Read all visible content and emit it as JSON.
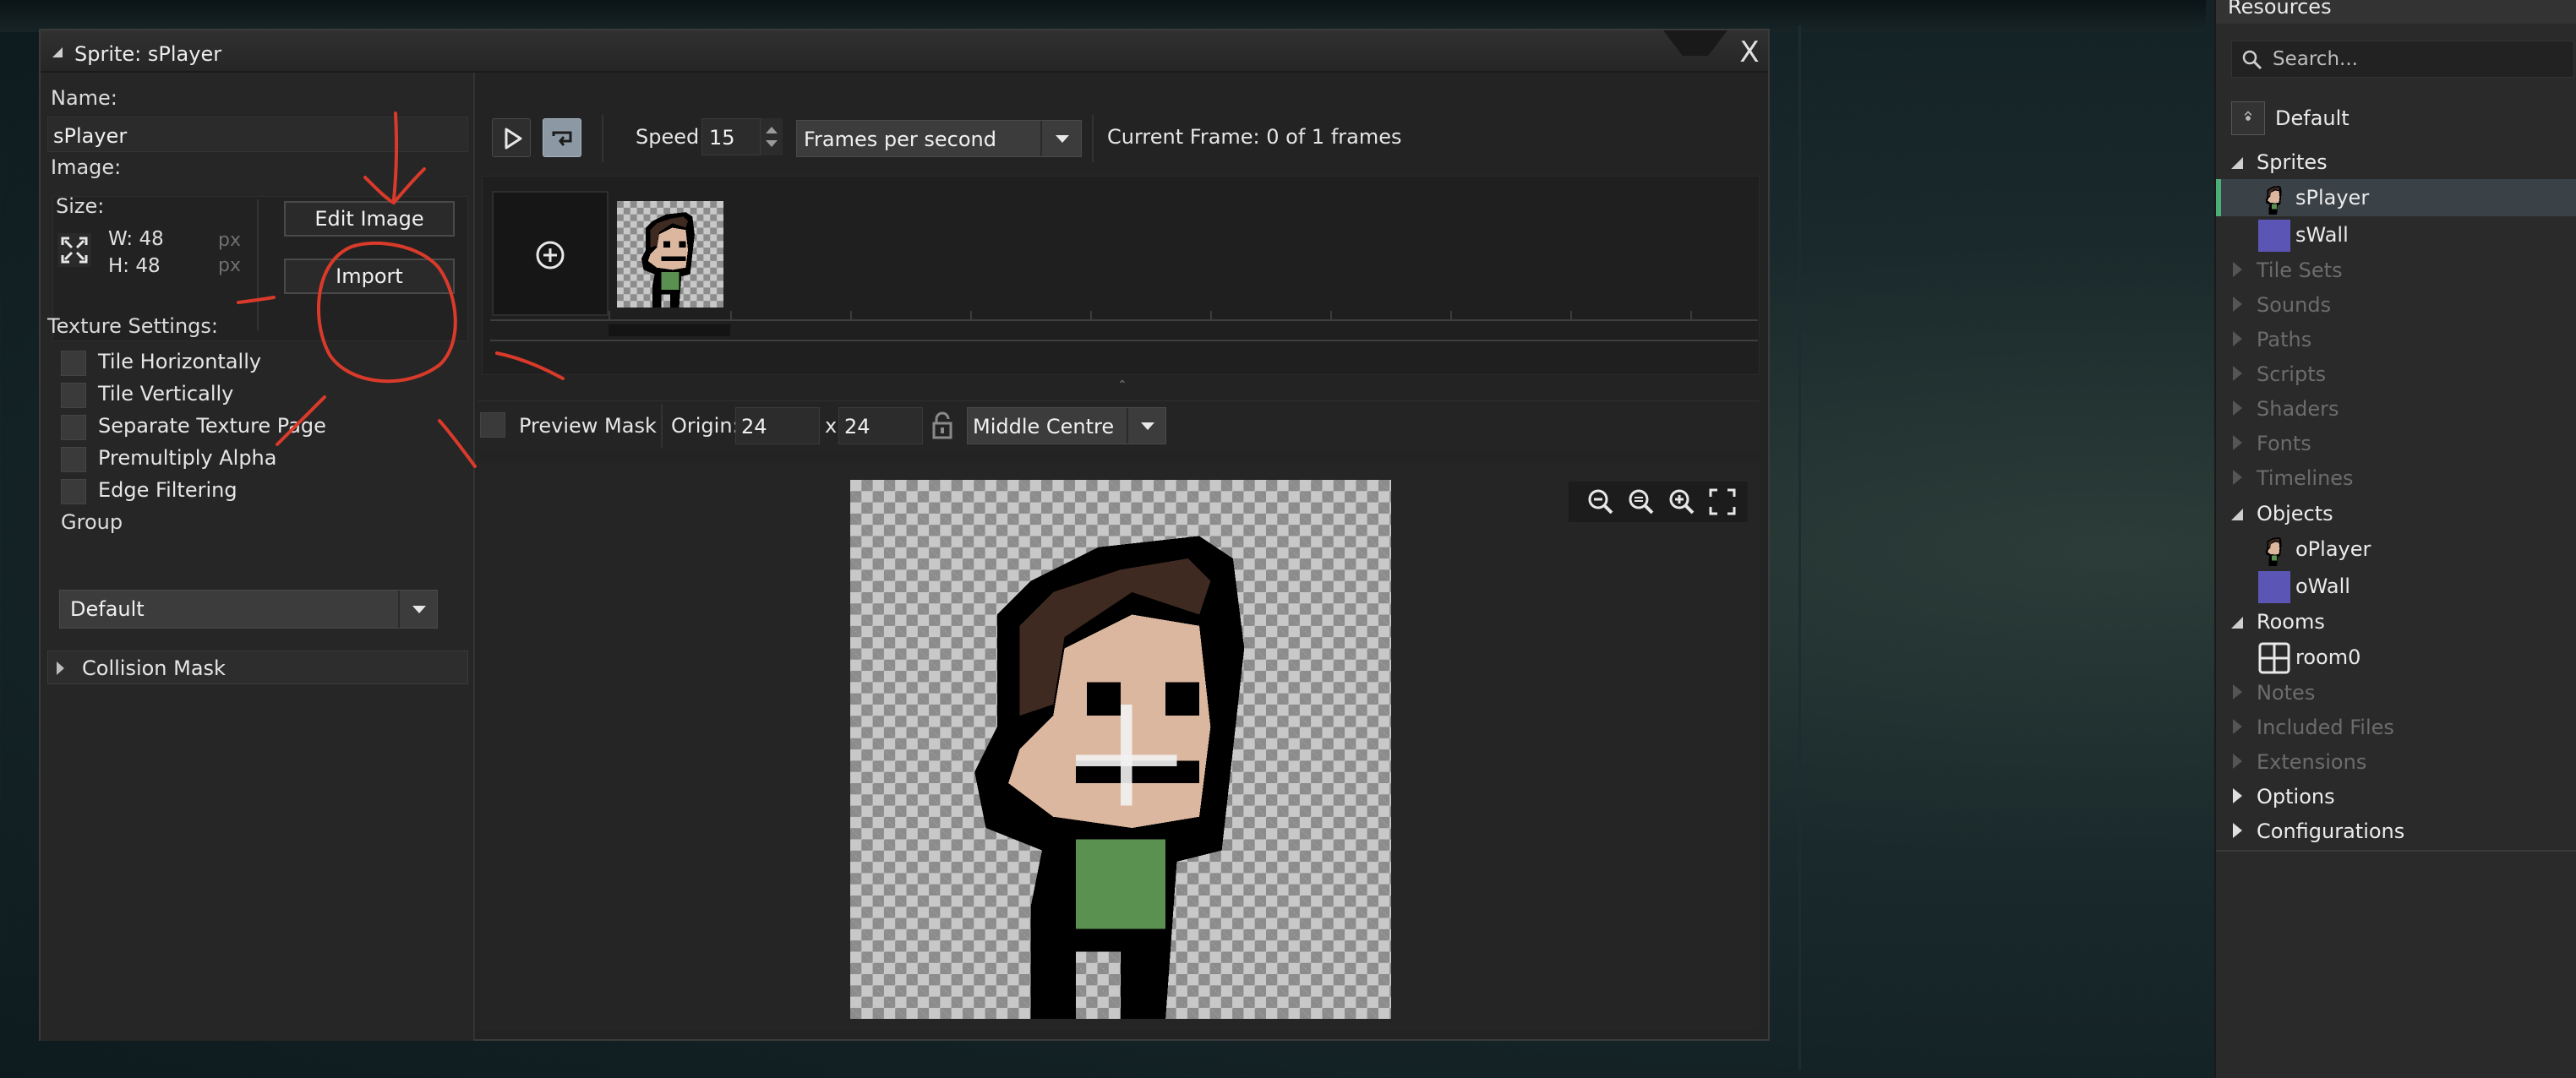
{
  "window": {
    "title": "Sprite: sPlayer",
    "close_label": "X"
  },
  "left_panel": {
    "name_label": "Name:",
    "name_value": "sPlayer",
    "image_label": "Image:",
    "size_label": "Size:",
    "width": "W: 48",
    "height": "H: 48",
    "unit": "px",
    "edit_image_button": "Edit Image",
    "import_button": "Import",
    "texture_settings_label": "Texture Settings:",
    "texture_options": [
      {
        "label": "Tile Horizontally",
        "checked": false
      },
      {
        "label": "Tile Vertically",
        "checked": false
      },
      {
        "label": "Separate Texture Page",
        "checked": false
      },
      {
        "label": "Premultiply Alpha",
        "checked": false
      },
      {
        "label": "Edge Filtering",
        "checked": false
      }
    ],
    "group_label": "Group",
    "group_value": "Default",
    "collision_mask_label": "Collision Mask"
  },
  "toolbar": {
    "speed_label": "Speed:",
    "speed_value": "15",
    "speed_unit": "Frames per second",
    "current_frame": "Current Frame: 0 of 1 frames"
  },
  "preview": {
    "preview_mask_label": "Preview Mask",
    "origin_label": "Origin:",
    "origin_x": "24",
    "x_separator": "x",
    "origin_y": "24",
    "origin_preset": "Middle Centre"
  },
  "resources": {
    "title": "Resources",
    "search_placeholder": "Search...",
    "config": "Default",
    "groups": [
      {
        "label": "Sprites",
        "open": true
      },
      {
        "label": "Tile Sets",
        "open": false
      },
      {
        "label": "Sounds",
        "open": false
      },
      {
        "label": "Paths",
        "open": false
      },
      {
        "label": "Scripts",
        "open": false
      },
      {
        "label": "Shaders",
        "open": false
      },
      {
        "label": "Fonts",
        "open": false
      },
      {
        "label": "Timelines",
        "open": false
      },
      {
        "label": "Objects",
        "open": true
      },
      {
        "label": "Rooms",
        "open": true
      },
      {
        "label": "Notes",
        "open": false
      },
      {
        "label": "Included Files",
        "open": false
      },
      {
        "label": "Extensions",
        "open": false
      },
      {
        "label": "Options",
        "open": false
      },
      {
        "label": "Configurations",
        "open": false
      }
    ],
    "sprites": [
      "sPlayer",
      "sWall"
    ],
    "objects": [
      "oPlayer",
      "oWall"
    ],
    "rooms": [
      "room0"
    ]
  },
  "colors": {
    "annotation_red": "#d93a2a",
    "wall_purple": "#5b56b5",
    "selection_accent": "#4caf7a",
    "shirt_green": "#5a9150",
    "skin": "#dcb7a0",
    "hair": "#3f2a22"
  }
}
